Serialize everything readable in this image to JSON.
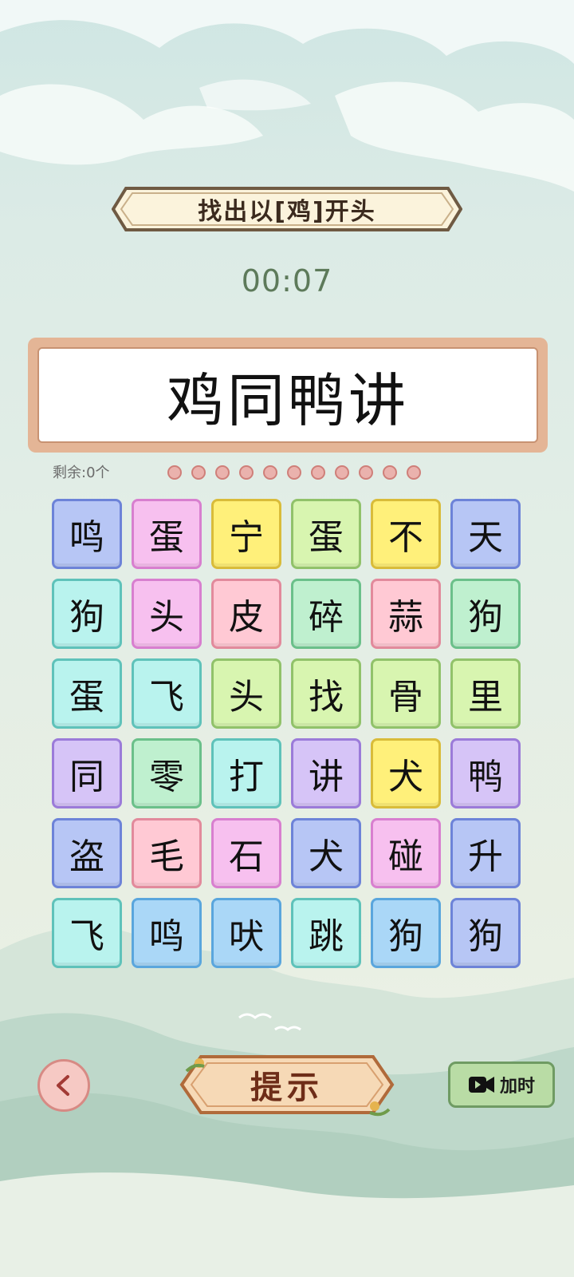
{
  "header": {
    "title": "找出以[鸡]开头",
    "timer": "00:07"
  },
  "answer": {
    "text": "鸡同鸭讲"
  },
  "progress": {
    "remaining_label": "剩余:0个",
    "dot_count": 11
  },
  "grid": {
    "tiles": [
      {
        "char": "鸣",
        "bg": "#b7c6f5",
        "border": "#6d83d8"
      },
      {
        "char": "蛋",
        "bg": "#f7c0ef",
        "border": "#d87fcf"
      },
      {
        "char": "宁",
        "bg": "#fff07a",
        "border": "#d9bc3a"
      },
      {
        "char": "蛋",
        "bg": "#d8f5b0",
        "border": "#91c26a"
      },
      {
        "char": "不",
        "bg": "#fff07a",
        "border": "#d9bc3a"
      },
      {
        "char": "天",
        "bg": "#b7c6f5",
        "border": "#6d83d8"
      },
      {
        "char": "狗",
        "bg": "#b9f3ee",
        "border": "#5fc2ba"
      },
      {
        "char": "头",
        "bg": "#f7c0ef",
        "border": "#d87fcf"
      },
      {
        "char": "皮",
        "bg": "#ffc9d4",
        "border": "#e28a9c"
      },
      {
        "char": "碎",
        "bg": "#bff0cf",
        "border": "#6bc08a"
      },
      {
        "char": "蒜",
        "bg": "#ffc9d4",
        "border": "#e28a9c"
      },
      {
        "char": "狗",
        "bg": "#bff0cf",
        "border": "#6bc08a"
      },
      {
        "char": "蛋",
        "bg": "#b9f3ee",
        "border": "#5fc2ba"
      },
      {
        "char": "飞",
        "bg": "#b9f3ee",
        "border": "#5fc2ba"
      },
      {
        "char": "头",
        "bg": "#d8f5b0",
        "border": "#91c26a"
      },
      {
        "char": "找",
        "bg": "#d8f5b0",
        "border": "#91c26a"
      },
      {
        "char": "骨",
        "bg": "#d8f5b0",
        "border": "#91c26a"
      },
      {
        "char": "里",
        "bg": "#d8f5b0",
        "border": "#91c26a"
      },
      {
        "char": "同",
        "bg": "#d6c4f7",
        "border": "#9b7bd9"
      },
      {
        "char": "零",
        "bg": "#bff0cf",
        "border": "#6bc08a"
      },
      {
        "char": "打",
        "bg": "#b9f3ee",
        "border": "#5fc2ba"
      },
      {
        "char": "讲",
        "bg": "#d6c4f7",
        "border": "#9b7bd9"
      },
      {
        "char": "犬",
        "bg": "#fff07a",
        "border": "#d9bc3a"
      },
      {
        "char": "鸭",
        "bg": "#d6c4f7",
        "border": "#9b7bd9"
      },
      {
        "char": "盗",
        "bg": "#b7c6f5",
        "border": "#6d83d8"
      },
      {
        "char": "毛",
        "bg": "#ffc9d4",
        "border": "#e28a9c"
      },
      {
        "char": "石",
        "bg": "#f7c0ef",
        "border": "#d87fcf"
      },
      {
        "char": "犬",
        "bg": "#b7c6f5",
        "border": "#6d83d8"
      },
      {
        "char": "碰",
        "bg": "#f7c0ef",
        "border": "#d87fcf"
      },
      {
        "char": "升",
        "bg": "#b7c6f5",
        "border": "#6d83d8"
      },
      {
        "char": "飞",
        "bg": "#b9f3ee",
        "border": "#5fc2ba"
      },
      {
        "char": "鸣",
        "bg": "#aad7f7",
        "border": "#5aa6dd"
      },
      {
        "char": "吠",
        "bg": "#aad7f7",
        "border": "#5aa6dd"
      },
      {
        "char": "跳",
        "bg": "#b9f3ee",
        "border": "#5fc2ba"
      },
      {
        "char": "狗",
        "bg": "#aad7f7",
        "border": "#5aa6dd"
      },
      {
        "char": "狗",
        "bg": "#b7c6f5",
        "border": "#6d83d8"
      }
    ]
  },
  "controls": {
    "back_icon": "chevron-left-icon",
    "hint_label": "提示",
    "addtime_icon": "video-camera-icon",
    "addtime_label": "加时"
  }
}
